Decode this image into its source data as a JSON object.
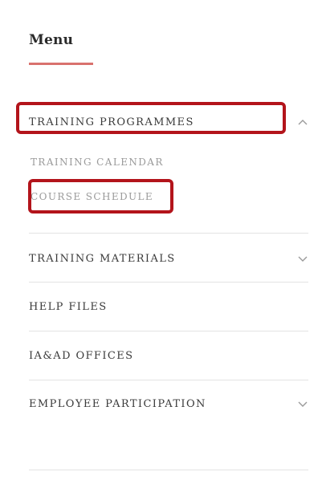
{
  "menu": {
    "title": "Menu",
    "accent_color": "#d9726e",
    "items": [
      {
        "label": "TRAINING PROGRAMMES",
        "icon": "chevron-up-icon",
        "expanded": true,
        "subitems": [
          {
            "label": "TRAINING CALENDAR"
          },
          {
            "label": "COURSE SCHEDULE"
          }
        ]
      },
      {
        "label": "TRAINING MATERIALS",
        "icon": "chevron-down-icon",
        "expanded": false
      },
      {
        "label": "HELP FILES"
      },
      {
        "label": "IA&AD OFFICES"
      },
      {
        "label": "EMPLOYEE PARTICIPATION",
        "icon": "chevron-down-icon",
        "expanded": false
      }
    ]
  },
  "highlight_color": "#b3141b"
}
